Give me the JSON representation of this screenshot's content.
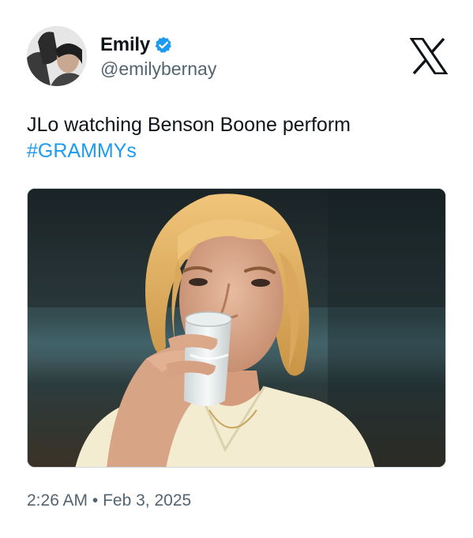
{
  "author": {
    "display_name": "Emily",
    "handle": "@emilybernay",
    "verified": true,
    "avatar_icon": "profile-photo-avatar",
    "verified_icon": "verified-badge-icon"
  },
  "platform": {
    "logo_icon": "x-logo-icon"
  },
  "tweet": {
    "text_line": "JLo watching Benson Boone perform",
    "hashtag": "#GRAMMYs",
    "media_icon": "photo-woman-drinking-milk"
  },
  "meta": {
    "time": "2:26 AM",
    "separator": "•",
    "date": "Feb 3, 2025"
  },
  "colors": {
    "text": "#0f1419",
    "secondary": "#536471",
    "link": "#1d9bf0",
    "verified": "#1d9bf0",
    "border": "#cfd9de"
  }
}
